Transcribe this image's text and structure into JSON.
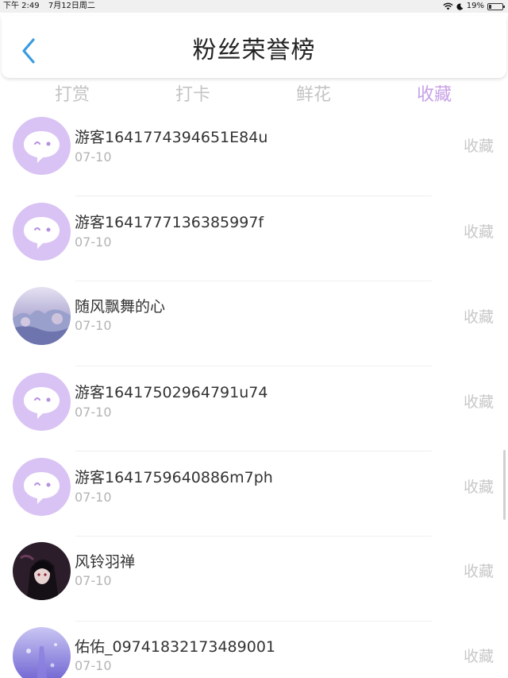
{
  "status_bar": {
    "time": "下午 2:49",
    "date": "7月12日周二",
    "battery": "19%"
  },
  "header": {
    "title": "粉丝荣誉榜"
  },
  "tabs": [
    {
      "label": "打赏",
      "active": false
    },
    {
      "label": "打卡",
      "active": false
    },
    {
      "label": "鲜花",
      "active": false
    },
    {
      "label": "收藏",
      "active": true
    }
  ],
  "fans": [
    {
      "name": "游客1641774394651E84u",
      "date": "07-10",
      "action": "收藏",
      "avatar": "guest"
    },
    {
      "name": "游客1641777136385997f",
      "date": "07-10",
      "action": "收藏",
      "avatar": "guest"
    },
    {
      "name": "随风飘舞的心",
      "date": "07-10",
      "action": "收藏",
      "avatar": "landscape"
    },
    {
      "name": "游客16417502964791u74",
      "date": "07-10",
      "action": "收藏",
      "avatar": "guest"
    },
    {
      "name": "游客1641759640886m7ph",
      "date": "07-10",
      "action": "收藏",
      "avatar": "guest"
    },
    {
      "name": "风铃羽禅",
      "date": "07-10",
      "action": "收藏",
      "avatar": "portrait"
    },
    {
      "name": "佑佑_09741832173489001",
      "date": "07-10",
      "action": "收藏",
      "avatar": "purple"
    }
  ],
  "colors": {
    "accent": "#c7a1e6",
    "back_arrow": "#3a9be0",
    "guest_avatar": "#d9c3f4"
  }
}
